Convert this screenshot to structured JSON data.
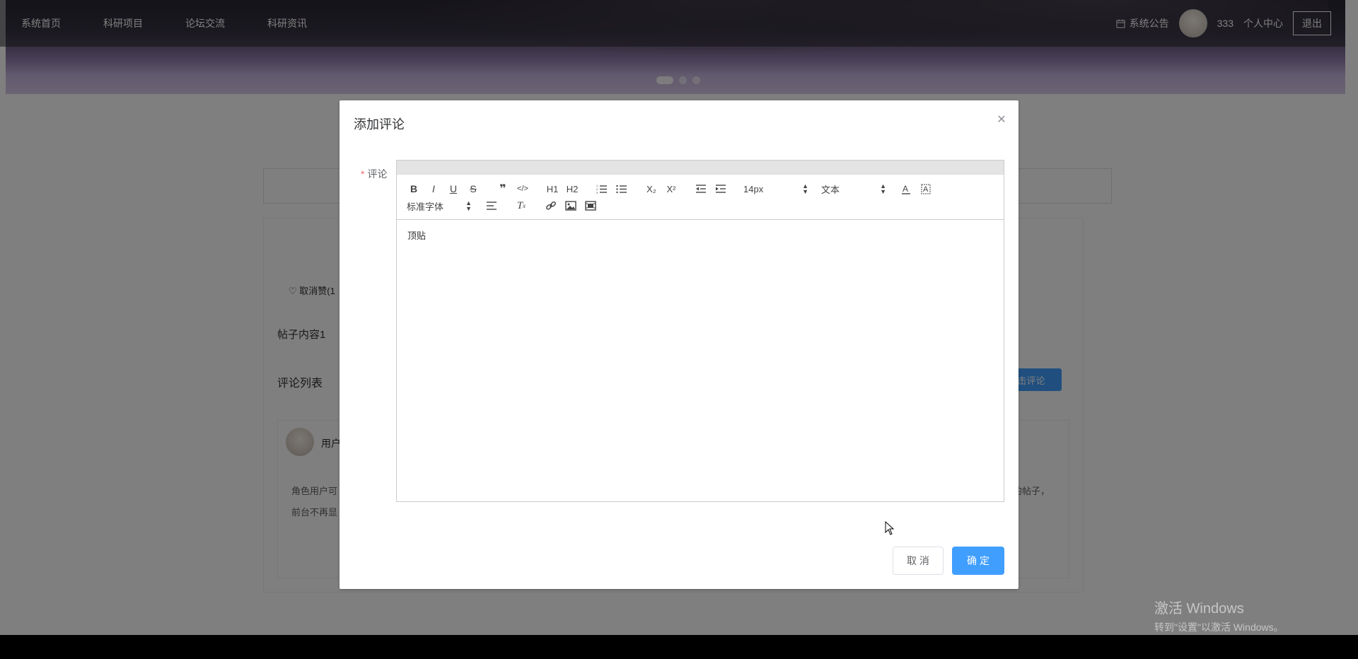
{
  "nav": {
    "items": [
      "系统首页",
      "科研项目",
      "论坛交流",
      "科研资讯"
    ],
    "notice_label": "系统公告",
    "username": "333",
    "profile_label": "个人中心",
    "logout_label": "退出"
  },
  "post": {
    "like_label": "♡ 取消赞(1",
    "content": "帖子内容1",
    "comment_list_title": "评论列表",
    "comment_button": "击评论"
  },
  "comment": {
    "user": "用户",
    "body_line1_start": "角色用户可",
    "body_line1_end": "的帖子，",
    "body_line2": "前台不再显"
  },
  "dialog": {
    "title": "添加评论",
    "close_icon": "close-icon",
    "field_label": "评论",
    "required_mark": "*",
    "content": "顶贴",
    "cancel_label": "取 消",
    "confirm_label": "确 定"
  },
  "toolbar": {
    "font_size": "14px",
    "header_type": "文本",
    "font_family": "标准字体",
    "buttons": [
      "B",
      "I",
      "U",
      "S",
      "❞",
      "</>",
      "H1",
      "H2",
      "ordered-list",
      "bullet-list",
      "X₂",
      "X²",
      "outdent",
      "indent",
      "color",
      "background",
      "align",
      "clean",
      "link",
      "image",
      "video"
    ]
  },
  "watermark": {
    "line1": "激活 Windows",
    "line2": "转到\"设置\"以激活 Windows。"
  }
}
